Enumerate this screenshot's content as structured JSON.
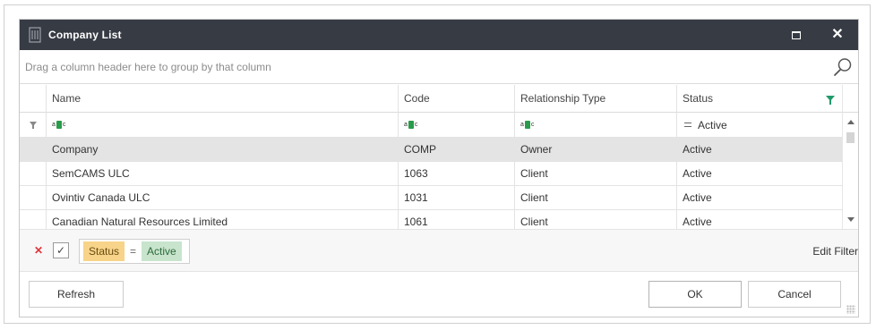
{
  "window": {
    "title": "Company List"
  },
  "group_panel": {
    "hint": "Drag a column header here to group by that column"
  },
  "grid": {
    "columns": [
      {
        "label": "Name"
      },
      {
        "label": "Code"
      },
      {
        "label": "Relationship Type"
      },
      {
        "label": "Status"
      }
    ],
    "filter_row": {
      "status_value": "Active"
    },
    "rows": [
      {
        "name": "Company",
        "code": "COMP",
        "relationship": "Owner",
        "status": "Active",
        "selected": true
      },
      {
        "name": "SemCAMS ULC",
        "code": "1063",
        "relationship": "Client",
        "status": "Active"
      },
      {
        "name": "Ovintiv Canada ULC",
        "code": "1031",
        "relationship": "Client",
        "status": "Active"
      },
      {
        "name": "Canadian Natural Resources Limited",
        "code": "1061",
        "relationship": "Client",
        "status": "Active"
      }
    ]
  },
  "filter_bar": {
    "check": "✓",
    "field": "Status",
    "operator": "=",
    "value": "Active",
    "edit_label": "Edit Filter"
  },
  "buttons": {
    "refresh": "Refresh",
    "ok": "OK",
    "cancel": "Cancel"
  },
  "colors": {
    "titlebar": "#373b44",
    "filter_field": "#f7d48a",
    "filter_value": "#c8e4cd",
    "filter_icon": "#1f9a6a",
    "clear_filter": "#e0333a"
  }
}
